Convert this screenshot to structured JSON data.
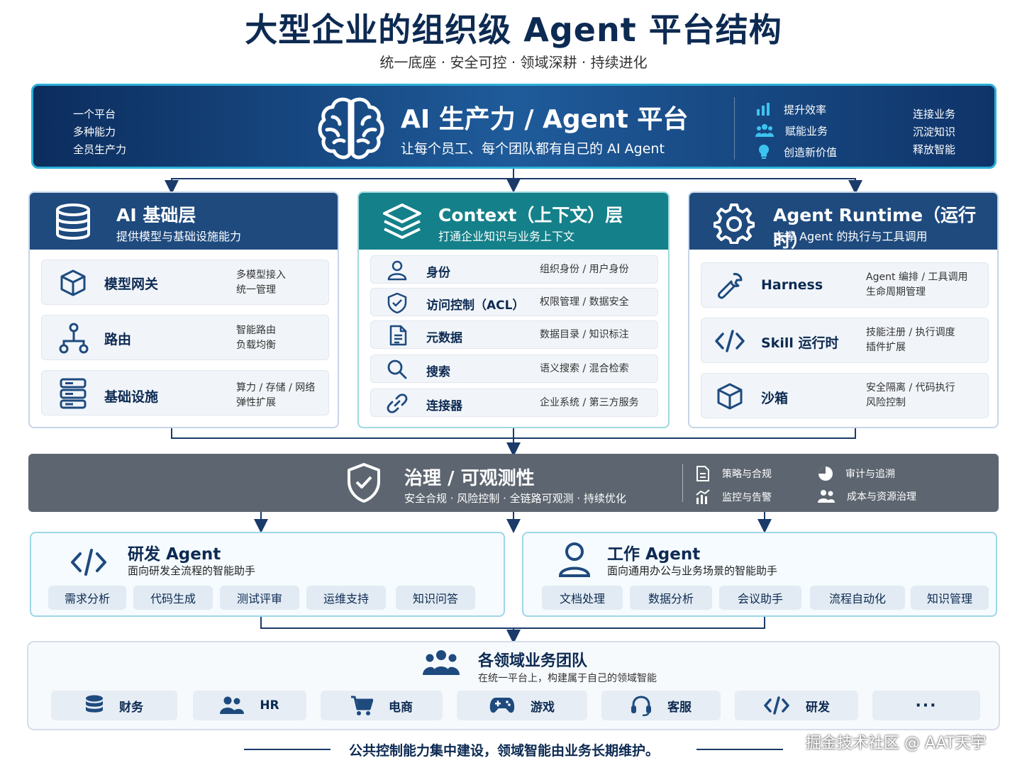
{
  "title": "大型企业的组织级 Agent 平台结构",
  "subtitle": "统一底座 · 安全可控 · 领域深耕 · 持续进化",
  "banner": {
    "left_lines": [
      "一个平台",
      "多种能力",
      "全员生产力"
    ],
    "title": "AI 生产力 / Agent 平台",
    "subtitle": "让每个员工、每个团队都有自己的 AI Agent",
    "right_items": [
      {
        "icon": "bar-chart-icon",
        "label": "提升效率"
      },
      {
        "icon": "users-icon",
        "label": "赋能业务"
      },
      {
        "icon": "lightbulb-icon",
        "label": "创造新价值"
      }
    ],
    "right_lines": [
      "连接业务",
      "沉淀知识",
      "释放智能"
    ]
  },
  "layers": [
    {
      "title": "AI 基础层",
      "subtitle": "提供模型与基础设施能力",
      "header_color": "#1e4a7e",
      "items": [
        {
          "icon": "cube-icon",
          "label": "模型网关",
          "desc": [
            "多模型接入",
            "统一管理"
          ]
        },
        {
          "icon": "routing-icon",
          "label": "路由",
          "desc": [
            "智能路由",
            "负载均衡"
          ]
        },
        {
          "icon": "server-icon",
          "label": "基础设施",
          "desc": [
            "算力 / 存储 / 网络",
            "弹性扩展"
          ]
        }
      ]
    },
    {
      "title": "Context（上下文）层",
      "subtitle": "打通企业知识与业务上下文",
      "header_color": "#14808a",
      "items": [
        {
          "icon": "user-icon",
          "label": "身份",
          "desc": [
            "组织身份 / 用户身份"
          ]
        },
        {
          "icon": "shield-check-icon",
          "label": "访问控制（ACL）",
          "desc": [
            "权限管理 / 数据安全"
          ]
        },
        {
          "icon": "document-icon",
          "label": "元数据",
          "desc": [
            "数据目录 / 知识标注"
          ]
        },
        {
          "icon": "search-icon",
          "label": "搜索",
          "desc": [
            "语义搜索 / 混合检索"
          ]
        },
        {
          "icon": "link-icon",
          "label": "连接器",
          "desc": [
            "企业系统 / 第三方服务"
          ]
        }
      ]
    },
    {
      "title": "Agent Runtime（运行时）",
      "subtitle": "支撑 Agent 的执行与工具调用",
      "header_color": "#1e4a7e",
      "items": [
        {
          "icon": "wrench-icon",
          "label": "Harness",
          "desc": [
            "Agent 编排 / 工具调用",
            "生命周期管理"
          ]
        },
        {
          "icon": "code-icon",
          "label": "Skill 运行时",
          "desc": [
            "技能注册 / 执行调度",
            "插件扩展"
          ]
        },
        {
          "icon": "cube-icon",
          "label": "沙箱",
          "desc": [
            "安全隔离 / 代码执行",
            "风险控制"
          ]
        }
      ]
    }
  ],
  "governance": {
    "title": "治理 / 可观测性",
    "subtitle": "安全合规 · 风险控制 · 全链路可观测 · 持续优化",
    "items": [
      {
        "icon": "policy-doc-icon",
        "label": "策略与合规"
      },
      {
        "icon": "pie-chart-icon",
        "label": "审计与追溯"
      },
      {
        "icon": "monitor-chart-icon",
        "label": "监控与告警"
      },
      {
        "icon": "users-icon",
        "label": "成本与资源治理"
      }
    ]
  },
  "agents": [
    {
      "icon": "code-icon",
      "title": "研发 Agent",
      "subtitle": "面向研发全流程的智能助手",
      "tags": [
        "需求分析",
        "代码生成",
        "测试评审",
        "运维支持",
        "知识问答"
      ]
    },
    {
      "icon": "person-icon",
      "title": "工作 Agent",
      "subtitle": "面向通用办公与业务场景的智能助手",
      "tags": [
        "文档处理",
        "数据分析",
        "会议助手",
        "流程自动化",
        "知识管理"
      ]
    }
  ],
  "teams": {
    "title": "各领域业务团队",
    "subtitle": "在统一平台上，构建属于自己的领域智能",
    "items": [
      {
        "icon": "database-icon",
        "label": "财务"
      },
      {
        "icon": "people-icon",
        "label": "HR"
      },
      {
        "icon": "cart-icon",
        "label": "电商"
      },
      {
        "icon": "gamepad-icon",
        "label": "游戏"
      },
      {
        "icon": "headset-icon",
        "label": "客服"
      },
      {
        "icon": "code-icon",
        "label": "研发"
      },
      {
        "icon": "more-icon",
        "label": "···"
      }
    ]
  },
  "footer": "公共控制能力集中建设，领域智能由业务长期维护。",
  "watermark": "掘金技术社区 @ AAT天宇"
}
